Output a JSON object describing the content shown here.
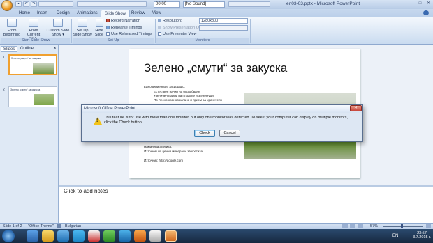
{
  "titlebar": {
    "view_mode": "00:00",
    "sound": "[No Sound]",
    "doc_title": "en03-03.pptx - Microsoft PowerPoint",
    "minimize": "–",
    "maximize": "□",
    "close": "✕"
  },
  "tabs": [
    "Home",
    "Insert",
    "Design",
    "Animations",
    "Slide Show",
    "Review",
    "View"
  ],
  "active_tab": "Slide Show",
  "ribbon": {
    "start": {
      "from_beginning": "From Beginning",
      "from_current": "From Current Slide",
      "custom": "Custom Slide Show ▾",
      "label": "Start Slide Show"
    },
    "setup": {
      "setup_show": "Set Up Slide Show",
      "hide_slide": "Hide Slide",
      "record_narration": "Record Narration",
      "rehearse": "Rehearse Timings",
      "use_rehearsed": "Use Rehearsed Timings",
      "label": "Set Up"
    },
    "monitors": {
      "resolution_label": "Resolution:",
      "resolution_value": "1280x800",
      "show_on": "Show Presentation On:",
      "presenter_view": "Use Presenter View",
      "label": "Monitors"
    }
  },
  "panel": {
    "tab_slides": "Slides",
    "tab_outline": "Outline",
    "thumb1_title": "Зелено „смути“ за закуска",
    "thumb2_title": "Зелено „смути“ за закуска",
    "num1": "1",
    "num2": "2"
  },
  "slide": {
    "title": "Зелено „смути“ за закуска",
    "bullets": [
      "Едновременно е засищащо;",
      "Естествен начин на отслабване",
      "Увеличен прием на плодове и зеленчуци",
      "По-лесно храносмилане и прием за хранителн"
    ],
    "bullets_bottom": [
      "Намалява апетита;",
      "Източник на ценни минерали за костите;"
    ],
    "source": "Източник: http://google.com"
  },
  "notes": {
    "placeholder": "Click to add notes"
  },
  "dialog": {
    "title": "Microsoft Office PowerPoint",
    "close": "✕",
    "message": "This feature is for use with more than one monitor, but only one monitor was detected. To see if your computer can display on multiple monitors, click the Check button.",
    "check": "Check",
    "cancel": "Cancel"
  },
  "status": {
    "slide_of": "Slide 1 of 2",
    "theme": "\"Office Theme\"",
    "language": "Bulgarian",
    "zoom": "57%"
  },
  "taskbar": {
    "lang": "EN",
    "time": "23:57",
    "date": "3.7.2015 г."
  },
  "colors": {
    "ribbon_bg": "#dbe7f5",
    "taskbar_bg": "#1f3656",
    "warning": "#f2c318",
    "dialog_close": "#c8453a"
  }
}
